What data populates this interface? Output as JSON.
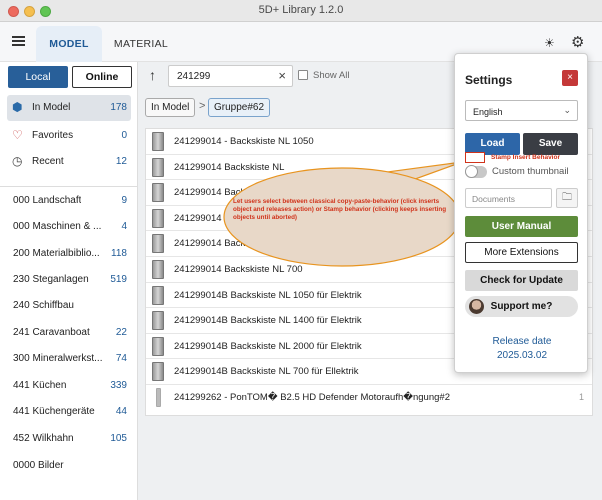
{
  "window": {
    "title": "5D+ Library 1.2.0",
    "edge_badge": "0"
  },
  "tabs": {
    "model": "MODEL",
    "material": "MATERIAL"
  },
  "sidebar": {
    "local_label": "Local",
    "online_label": "Online",
    "items": [
      {
        "label": "In Model",
        "count": "178"
      },
      {
        "label": "Favorites",
        "count": "0"
      },
      {
        "label": "Recent",
        "count": "12"
      }
    ],
    "categories": [
      {
        "label": "000 Landschaft",
        "count": "9"
      },
      {
        "label": "000 Maschinen & ...",
        "count": "4"
      },
      {
        "label": "200 Materialbiblio...",
        "count": "118"
      },
      {
        "label": "230 Steganlagen",
        "count": "519"
      },
      {
        "label": "240 Schiffbau",
        "count": ""
      },
      {
        "label": "241 Caravanboat",
        "count": "22"
      },
      {
        "label": "300 Mineralwerkst...",
        "count": "74"
      },
      {
        "label": "441 Küchen",
        "count": "339"
      },
      {
        "label": "441 Küchengeräte",
        "count": "44"
      },
      {
        "label": "452 Wilkhahn",
        "count": "105"
      },
      {
        "label": "0000 Bilder",
        "count": ""
      }
    ]
  },
  "search": {
    "value": "241299",
    "show_all_label": "Show All"
  },
  "breadcrumb": {
    "root": "In Model",
    "sep": ">",
    "current": "Gruppe#62"
  },
  "results": [
    {
      "name": "241299014 - Backskiste NL 1050",
      "qty": ""
    },
    {
      "name": "241299014 Backskiste NL",
      "qty": ""
    },
    {
      "name": "241299014 Backs",
      "qty": ""
    },
    {
      "name": "241299014 Backs",
      "qty": ""
    },
    {
      "name": "241299014 Backskiste NL",
      "qty": ""
    },
    {
      "name": "241299014 Backskiste NL 700",
      "qty": ""
    },
    {
      "name": "241299014B Backskiste NL 1050 für Elektrik",
      "qty": ""
    },
    {
      "name": "241299014B Backskiste NL 1400 für Elektrik",
      "qty": ""
    },
    {
      "name": "241299014B Backskiste NL 2000 für Elektrik",
      "qty": ""
    },
    {
      "name": "241299014B Backskiste NL 700 für Ellektrik",
      "qty": ""
    },
    {
      "name": "241299262 - PonTOM� B2.5 HD Defender Motoraufh�ngung#2",
      "qty": "1"
    }
  ],
  "callout": {
    "text": "Let users select between classical copy-paste-behavior (click inserts object and releases action) or Stamp behavior (clicking keeps inserting objects until aborted)",
    "color": "#d0331b",
    "fill": "#e8d8c8",
    "stroke": "#e8941f"
  },
  "settings": {
    "title": "Settings",
    "close": "×",
    "language": "English",
    "load_label": "Load",
    "save_label": "Save",
    "stamp_label": "Stamp Insert Behavior",
    "thumbnail_label": "Custom thumbnail",
    "documents_placeholder": "Documents",
    "user_manual": "User Manual",
    "more_extensions": "More Extensions",
    "check_update": "Check for Update",
    "support": "Support me?",
    "release_label": "Release date",
    "release_date": "2025.03.02"
  }
}
